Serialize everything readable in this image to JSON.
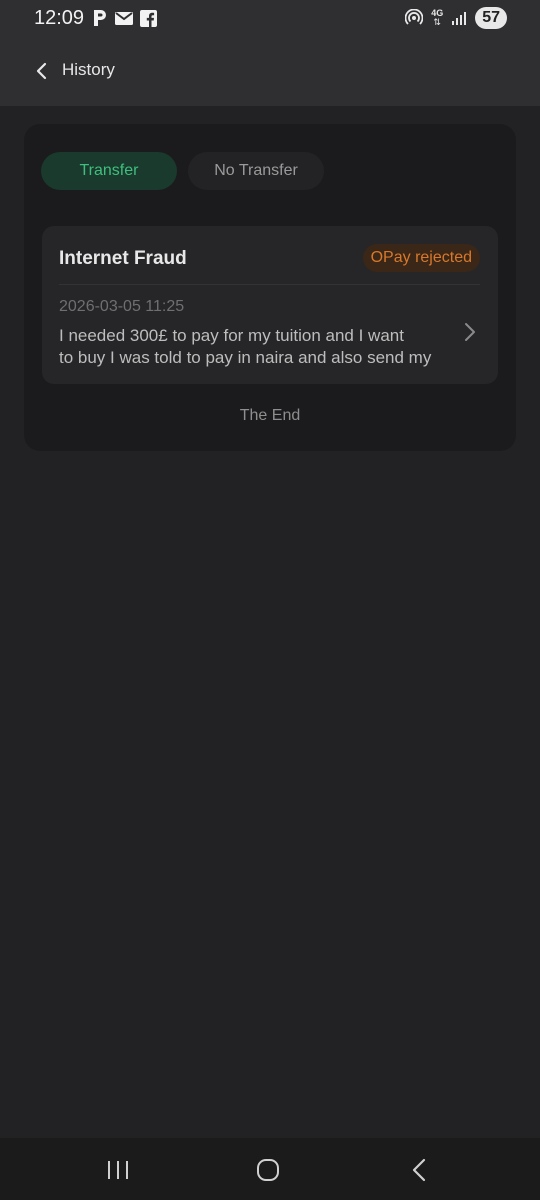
{
  "status_bar": {
    "time": "12:09",
    "left_icons": [
      "p-icon",
      "mail-icon",
      "facebook-icon"
    ],
    "network": "4G",
    "battery": "57"
  },
  "header": {
    "title": "History"
  },
  "tabs": [
    {
      "label": "Transfer",
      "active": true
    },
    {
      "label": "No Transfer",
      "active": false
    }
  ],
  "records": [
    {
      "title": "Internet Fraud",
      "status": "OPay rejected",
      "datetime": "2026-03-05 11:25",
      "description_line1": "I needed 300£ to pay for my tuition and I want",
      "description_line2": "to buy I was told to pay in naira and also send my"
    }
  ],
  "footer_text": "The End",
  "colors": {
    "accent_green": "#3fbf7d",
    "status_orange": "#d8782a",
    "background": "#222224"
  }
}
